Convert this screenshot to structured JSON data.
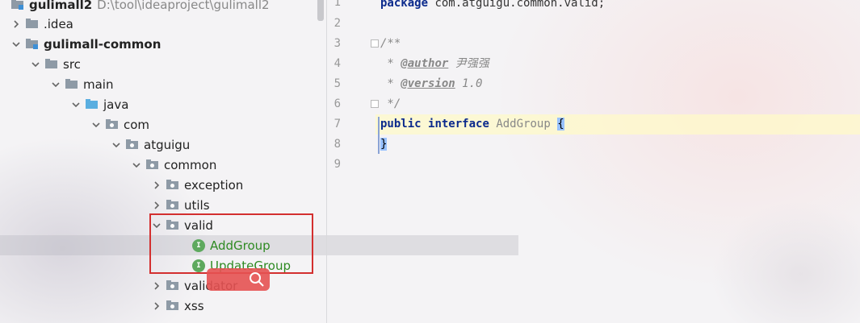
{
  "project_tree": {
    "root": {
      "name": "gulimall2",
      "path": "D:\\tool\\ideaproject\\gulimall2"
    },
    "items": [
      {
        "label": ".idea"
      },
      {
        "label": "gulimall-common"
      },
      {
        "label": "src"
      },
      {
        "label": "main"
      },
      {
        "label": "java"
      },
      {
        "label": "com"
      },
      {
        "label": "atguigu"
      },
      {
        "label": "common"
      },
      {
        "label": "exception"
      },
      {
        "label": "utils"
      },
      {
        "label": "valid"
      },
      {
        "label": "AddGroup"
      },
      {
        "label": "UpdateGroup"
      },
      {
        "label": "validator"
      },
      {
        "label": "xss"
      }
    ],
    "interface_icon_letter": "I"
  },
  "editor": {
    "line_numbers": [
      "1",
      "2",
      "3",
      "4",
      "5",
      "6",
      "7",
      "8",
      "9"
    ],
    "line1": {
      "kw": "package",
      "rest": " com.atguigu.common.valid;"
    },
    "line3": "/**",
    "line4": {
      "prefix": " * ",
      "tag": "@author",
      "rest": " 尹强强"
    },
    "line5": {
      "prefix": " * ",
      "tag": "@version",
      "rest": " 1.0"
    },
    "line6": " */",
    "line7": {
      "kw1": "public",
      "kw2": "interface",
      "name": "AddGroup",
      "brace": "{"
    },
    "line8": "}"
  },
  "colors": {
    "accent_red": "#d32f2f",
    "interface_green": "#5ea95e",
    "keyword_blue": "#0b2a8c"
  }
}
